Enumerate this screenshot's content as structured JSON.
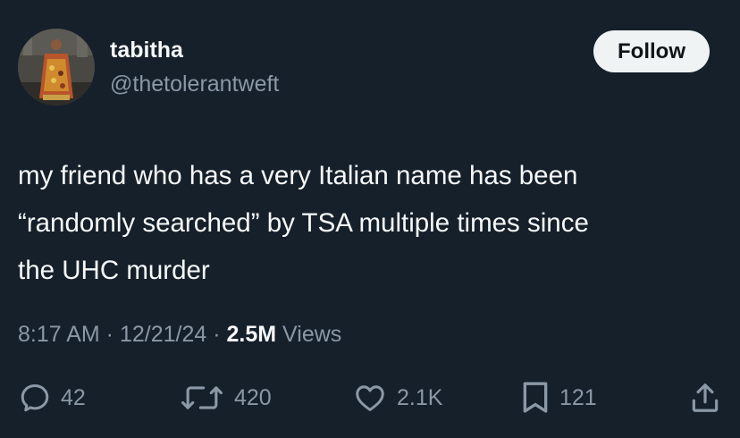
{
  "user": {
    "display_name": "tabitha",
    "handle": "@thetolerantweft"
  },
  "follow_label": "Follow",
  "tweet": {
    "lines": [
      "my friend who has a very Italian name has been",
      "“randomly searched” by TSA multiple times since",
      "the UHC murder"
    ]
  },
  "meta": {
    "time": "8:17 AM",
    "sep1": " · ",
    "date": "12/21/24",
    "sep2": " · ",
    "views_count": "2.5M",
    "views_label": " Views"
  },
  "actions": {
    "replies": "42",
    "reposts": "420",
    "likes": "2.1K",
    "bookmarks": "121"
  },
  "icons": {
    "reply": "reply-icon",
    "repost": "repost-icon",
    "like": "heart-icon",
    "bookmark": "bookmark-icon",
    "share": "share-icon"
  },
  "colors": {
    "background": "#15202b",
    "text": "#f7f9f9",
    "secondary_text": "#8b98a5",
    "follow_button_bg": "#eff3f4"
  }
}
